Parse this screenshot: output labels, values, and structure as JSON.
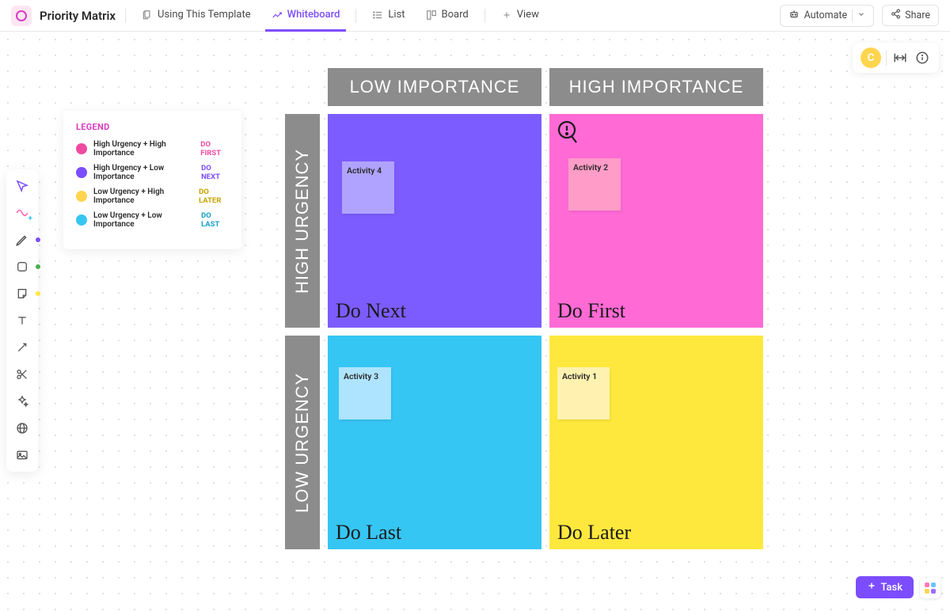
{
  "header": {
    "title": "Priority Matrix",
    "tabs": [
      {
        "label": "Using This Template"
      },
      {
        "label": "Whiteboard"
      },
      {
        "label": "List"
      },
      {
        "label": "Board"
      },
      {
        "label": "View"
      }
    ],
    "automate": "Automate",
    "share": "Share"
  },
  "corner": {
    "avatar_letter": "C"
  },
  "legend": {
    "title": "LEGEND",
    "rows": [
      {
        "text": "High Urgency + High Importance",
        "action": "DO FIRST",
        "swatch": "#ef4aa0",
        "action_color": "#ef4aa0"
      },
      {
        "text": "High Urgency + Low Importance",
        "action": "DO NEXT",
        "swatch": "#7c4dff",
        "action_color": "#7c4dff"
      },
      {
        "text": "Low Urgency + High Importance",
        "action": "DO LATER",
        "swatch": "#ffd54f",
        "action_color": "#caa300"
      },
      {
        "text": "Low Urgency + Low Importance",
        "action": "DO LAST",
        "swatch": "#36c6f4",
        "action_color": "#1a9ecc"
      }
    ]
  },
  "matrix": {
    "col_headers": [
      "LOW IMPORTANCE",
      "HIGH IMPORTANCE"
    ],
    "row_headers": [
      "HIGH URGENCY",
      "LOW URGENCY"
    ],
    "quads": {
      "do_next": {
        "label": "Do Next",
        "bg": "#7c5cff",
        "sticky_bg": "#b0a3ff",
        "sticky_text": "Activity 4"
      },
      "do_first": {
        "label": "Do First",
        "bg": "#ff6ad5",
        "sticky_bg": "#ff9cc8",
        "sticky_text": "Activity 2"
      },
      "do_last": {
        "label": "Do Last",
        "bg": "#36c6f4",
        "sticky_bg": "#aee4ff",
        "sticky_text": "Activity 3"
      },
      "do_later": {
        "label": "Do Later",
        "bg": "#ffe83d",
        "sticky_bg": "#fff2b0",
        "sticky_text": "Activity 1"
      }
    }
  },
  "task_button": "Task"
}
